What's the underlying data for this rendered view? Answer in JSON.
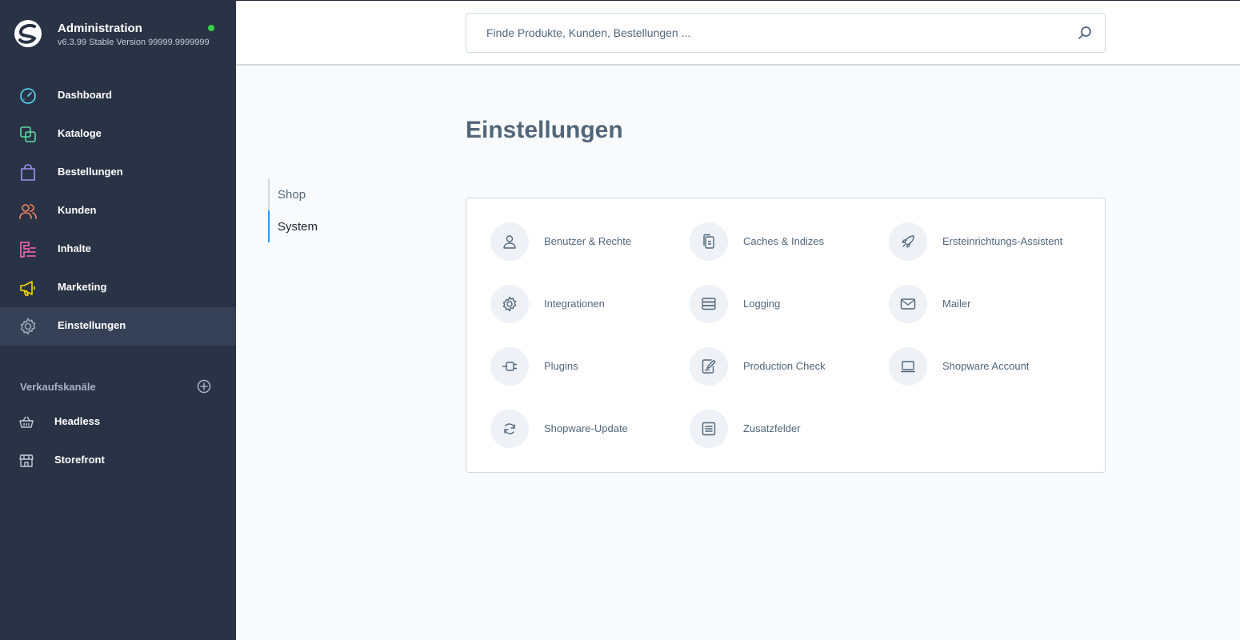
{
  "app": {
    "title": "Administration",
    "version": "v6.3.99 Stable Version 99999.9999999",
    "status_color": "#37d046"
  },
  "sidebar": {
    "items": [
      {
        "label": "Dashboard",
        "icon": "dashboard-icon",
        "color": "#57d9f5"
      },
      {
        "label": "Kataloge",
        "icon": "catalog-icon",
        "color": "#57d9a3"
      },
      {
        "label": "Bestellungen",
        "icon": "orders-icon",
        "color": "#a092f0"
      },
      {
        "label": "Kunden",
        "icon": "customers-icon",
        "color": "#f88962"
      },
      {
        "label": "Inhalte",
        "icon": "content-icon",
        "color": "#ff68b4"
      },
      {
        "label": "Marketing",
        "icon": "marketing-icon",
        "color": "#ffd700"
      },
      {
        "label": "Einstellungen",
        "icon": "settings-icon",
        "color": "#9aa8b5",
        "active": true
      }
    ],
    "channels_title": "Verkaufskanäle",
    "channels": [
      {
        "label": "Headless",
        "icon": "basket-icon"
      },
      {
        "label": "Storefront",
        "icon": "storefront-icon"
      }
    ]
  },
  "search": {
    "placeholder": "Finde Produkte, Kunden, Bestellungen ..."
  },
  "page": {
    "title": "Einstellungen"
  },
  "subnav": {
    "items": [
      {
        "label": "Shop",
        "active": false
      },
      {
        "label": "System",
        "active": true
      }
    ]
  },
  "settings": {
    "items": [
      {
        "label": "Benutzer & Rechte",
        "icon": "user-icon"
      },
      {
        "label": "Caches & Indizes",
        "icon": "copy-icon"
      },
      {
        "label": "Ersteinrichtungs-Assistent",
        "icon": "rocket-icon"
      },
      {
        "label": "Integrationen",
        "icon": "gear-icon"
      },
      {
        "label": "Logging",
        "icon": "server-icon"
      },
      {
        "label": "Mailer",
        "icon": "envelope-icon"
      },
      {
        "label": "Plugins",
        "icon": "plug-icon"
      },
      {
        "label": "Production Check",
        "icon": "edit-document-icon"
      },
      {
        "label": "Shopware Account",
        "icon": "laptop-icon"
      },
      {
        "label": "Shopware-Update",
        "icon": "refresh-icon"
      },
      {
        "label": "Zusatzfelder",
        "icon": "list-icon"
      }
    ]
  }
}
